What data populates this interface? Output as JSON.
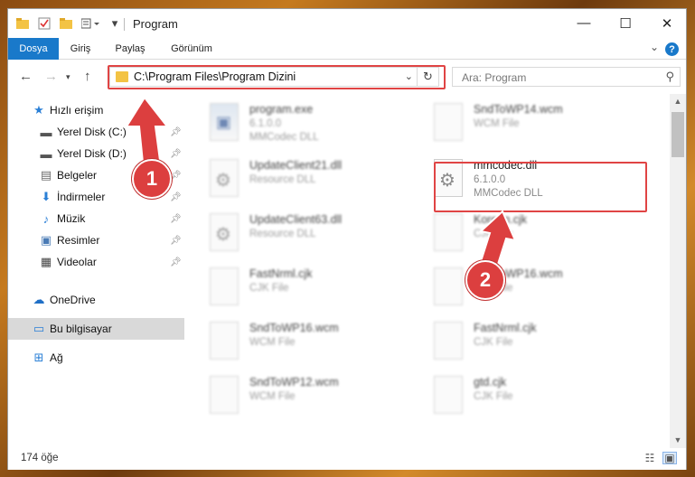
{
  "window": {
    "title": "Program",
    "controls": {
      "minimize": "—",
      "maximize": "☐",
      "close": "✕"
    }
  },
  "ribbon": {
    "tabs": [
      {
        "label": "Dosya",
        "active": true
      },
      {
        "label": "Giriş",
        "active": false
      },
      {
        "label": "Paylaş",
        "active": false
      },
      {
        "label": "Görünüm",
        "active": false
      }
    ],
    "help": "?"
  },
  "address": {
    "path": "C:\\Program Files\\Program Dizini",
    "search_placeholder": "Ara: Program"
  },
  "sidebar": {
    "items": [
      {
        "label": "Hızlı erişim",
        "icon": "star-icon",
        "glyph": "★",
        "color": "#2a7fd6",
        "pinned": false
      },
      {
        "label": "Yerel Disk (C:)",
        "icon": "drive-icon",
        "glyph": "▬",
        "color": "#555555",
        "pinned": true
      },
      {
        "label": "Yerel Disk (D:)",
        "icon": "drive-icon",
        "glyph": "▬",
        "color": "#555555",
        "pinned": true
      },
      {
        "label": "Belgeler",
        "icon": "documents-icon",
        "glyph": "▤",
        "color": "#6b6b6b",
        "pinned": true
      },
      {
        "label": "İndirmeler",
        "icon": "download-icon",
        "glyph": "⬇",
        "color": "#2a7fd6",
        "pinned": true
      },
      {
        "label": "Müzik",
        "icon": "music-icon",
        "glyph": "♪",
        "color": "#2a7fd6",
        "pinned": true
      },
      {
        "label": "Resimler",
        "icon": "pictures-icon",
        "glyph": "▣",
        "color": "#4a7bb5",
        "pinned": true
      },
      {
        "label": "Videolar",
        "icon": "video-icon",
        "glyph": "▦",
        "color": "#444444",
        "pinned": true
      },
      {
        "label": "OneDrive",
        "icon": "cloud-icon",
        "glyph": "☁",
        "color": "#1f6fc6",
        "pinned": false
      },
      {
        "label": "Bu bilgisayar",
        "icon": "computer-icon",
        "glyph": "▭",
        "color": "#2a7fd6",
        "pinned": false,
        "selected": true
      },
      {
        "label": "Ağ",
        "icon": "network-icon",
        "glyph": "⊞",
        "color": "#2a7fd6",
        "pinned": false
      }
    ]
  },
  "files": {
    "left": [
      {
        "name": "program.exe",
        "sub": "6.1.0.0",
        "sub2": "MMCodec DLL",
        "kind": "exe"
      },
      {
        "name": "UpdateClient21.dll",
        "sub": "Resource DLL",
        "sub2": "",
        "kind": "gear"
      },
      {
        "name": "UpdateClient63.dll",
        "sub": "Resource DLL",
        "sub2": "",
        "kind": "gear"
      },
      {
        "name": "FastNrml.cjk",
        "sub": "CJK File",
        "sub2": "",
        "kind": "blank"
      },
      {
        "name": "SndToWP16.wcm",
        "sub": "WCM File",
        "sub2": "",
        "kind": "blank"
      },
      {
        "name": "SndToWP12.wcm",
        "sub": "WCM File",
        "sub2": "",
        "kind": "blank"
      }
    ],
    "right": [
      {
        "name": "SndToWP14.wcm",
        "sub": "WCM File",
        "sub2": "",
        "kind": "blank"
      },
      {
        "name": "mmcodec.dll",
        "sub": "6.1.0.0",
        "sub2": "MMCodec DLL",
        "kind": "gear",
        "highlight": true
      },
      {
        "name": "Korean.cjk",
        "sub": "CJK File",
        "sub2": "",
        "kind": "blank"
      },
      {
        "name": "SndToWP16.wcm",
        "sub": "CJK File",
        "sub2": "",
        "kind": "blank"
      },
      {
        "name": "FastNrml.cjk",
        "sub": "CJK File",
        "sub2": "",
        "kind": "blank"
      },
      {
        "name": "gtd.cjk",
        "sub": "CJK File",
        "sub2": "",
        "kind": "blank"
      }
    ]
  },
  "status": {
    "count": "174 öğe"
  },
  "annotations": [
    {
      "label": "1"
    },
    {
      "label": "2"
    }
  ],
  "colors": {
    "accent": "#1979ca",
    "highlight": "#e04444",
    "badge": "#dc3f3f"
  }
}
